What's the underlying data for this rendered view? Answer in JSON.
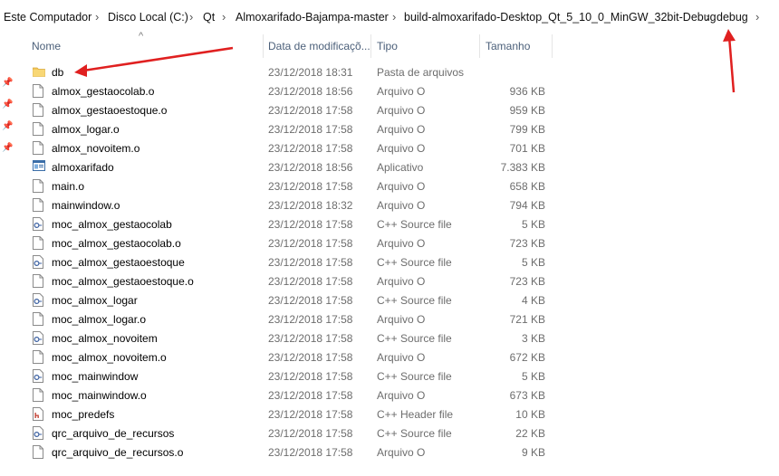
{
  "breadcrumb": [
    {
      "label": "Este Computador"
    },
    {
      "label": "Disco Local (C:)"
    },
    {
      "label": "Qt"
    },
    {
      "label": "Almoxarifado-Bajampa-master"
    },
    {
      "label": "build-almoxarifado-Desktop_Qt_5_10_0_MinGW_32bit-Debug"
    },
    {
      "label": "debug"
    }
  ],
  "columns": {
    "name": "Nome",
    "date": "Data de modificaçõ...",
    "type": "Tipo",
    "size": "Tamanho"
  },
  "files": [
    {
      "name": "db",
      "date": "23/12/2018 18:31",
      "type": "Pasta de arquivos",
      "size": "",
      "icon": "folder-icon"
    },
    {
      "name": "almox_gestaocolab.o",
      "date": "23/12/2018 18:56",
      "type": "Arquivo O",
      "size": "936 KB",
      "icon": "file-icon"
    },
    {
      "name": "almox_gestaoestoque.o",
      "date": "23/12/2018 17:58",
      "type": "Arquivo O",
      "size": "959 KB",
      "icon": "file-icon"
    },
    {
      "name": "almox_logar.o",
      "date": "23/12/2018 17:58",
      "type": "Arquivo O",
      "size": "799 KB",
      "icon": "file-icon"
    },
    {
      "name": "almox_novoitem.o",
      "date": "23/12/2018 17:58",
      "type": "Arquivo O",
      "size": "701 KB",
      "icon": "file-icon"
    },
    {
      "name": "almoxarifado",
      "date": "23/12/2018 18:56",
      "type": "Aplicativo",
      "size": "7.383 KB",
      "icon": "application-icon"
    },
    {
      "name": "main.o",
      "date": "23/12/2018 17:58",
      "type": "Arquivo O",
      "size": "658 KB",
      "icon": "file-icon"
    },
    {
      "name": "mainwindow.o",
      "date": "23/12/2018 18:32",
      "type": "Arquivo O",
      "size": "794 KB",
      "icon": "file-icon"
    },
    {
      "name": "moc_almox_gestaocolab",
      "date": "23/12/2018 17:58",
      "type": "C++ Source file",
      "size": "5 KB",
      "icon": "cpp-source-icon"
    },
    {
      "name": "moc_almox_gestaocolab.o",
      "date": "23/12/2018 17:58",
      "type": "Arquivo O",
      "size": "723 KB",
      "icon": "file-icon"
    },
    {
      "name": "moc_almox_gestaoestoque",
      "date": "23/12/2018 17:58",
      "type": "C++ Source file",
      "size": "5 KB",
      "icon": "cpp-source-icon"
    },
    {
      "name": "moc_almox_gestaoestoque.o",
      "date": "23/12/2018 17:58",
      "type": "Arquivo O",
      "size": "723 KB",
      "icon": "file-icon"
    },
    {
      "name": "moc_almox_logar",
      "date": "23/12/2018 17:58",
      "type": "C++ Source file",
      "size": "4 KB",
      "icon": "cpp-source-icon"
    },
    {
      "name": "moc_almox_logar.o",
      "date": "23/12/2018 17:58",
      "type": "Arquivo O",
      "size": "721 KB",
      "icon": "file-icon"
    },
    {
      "name": "moc_almox_novoitem",
      "date": "23/12/2018 17:58",
      "type": "C++ Source file",
      "size": "3 KB",
      "icon": "cpp-source-icon"
    },
    {
      "name": "moc_almox_novoitem.o",
      "date": "23/12/2018 17:58",
      "type": "Arquivo O",
      "size": "672 KB",
      "icon": "file-icon"
    },
    {
      "name": "moc_mainwindow",
      "date": "23/12/2018 17:58",
      "type": "C++ Source file",
      "size": "5 KB",
      "icon": "cpp-source-icon"
    },
    {
      "name": "moc_mainwindow.o",
      "date": "23/12/2018 17:58",
      "type": "Arquivo O",
      "size": "673 KB",
      "icon": "file-icon"
    },
    {
      "name": "moc_predefs",
      "date": "23/12/2018 17:58",
      "type": "C++ Header file",
      "size": "10 KB",
      "icon": "cpp-header-icon"
    },
    {
      "name": "qrc_arquivo_de_recursos",
      "date": "23/12/2018 17:58",
      "type": "C++ Source file",
      "size": "22 KB",
      "icon": "cpp-source-icon"
    },
    {
      "name": "qrc_arquivo_de_recursos.o",
      "date": "23/12/2018 17:58",
      "type": "Arquivo O",
      "size": "9 KB",
      "icon": "file-icon"
    }
  ],
  "colors": {
    "header_text": "#4c607a",
    "annotation_arrow": "#e02020",
    "folder": "#f3c65a"
  }
}
